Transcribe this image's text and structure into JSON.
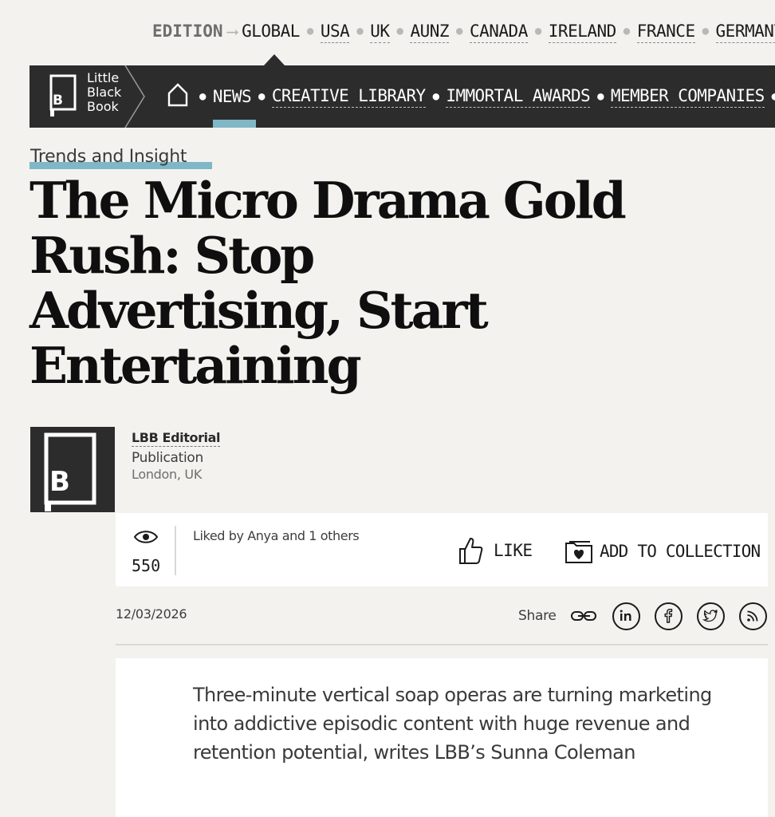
{
  "edition": {
    "label": "EDITION",
    "arrow": "⟶",
    "items": [
      "GLOBAL",
      "USA",
      "UK",
      "AUNZ",
      "CANADA",
      "IRELAND",
      "FRANCE",
      "GERMANY"
    ],
    "selected": "GLOBAL"
  },
  "nav": {
    "logo_lines": [
      "Little",
      "Black",
      "Book"
    ],
    "logo_letter": "B",
    "items": [
      "NEWS",
      "CREATIVE LIBRARY",
      "IMMORTAL AWARDS",
      "MEMBER COMPANIES"
    ],
    "active": "NEWS"
  },
  "article": {
    "category": "Trends and Insight",
    "headline_lines": [
      "The Micro Drama Gold",
      "Rush: Stop",
      "Advertising, Start",
      "Entertaining"
    ],
    "author": {
      "name": "LBB Editorial",
      "type": "Publication",
      "location": "London, UK"
    },
    "views": "550",
    "liked_by": "Liked by Anya and 1 others",
    "like_label": "LIKE",
    "collect_label": "ADD TO COLLECTION",
    "date": "12/03/2026",
    "share_label": "Share",
    "share_icons": [
      "link-icon",
      "linkedin-icon",
      "facebook-icon",
      "twitter-icon",
      "rss-icon"
    ],
    "standfirst": "Three-minute vertical soap operas are turning marketing into addictive episodic content with huge revenue and retention potential, writes LBB’s Sunna Coleman"
  },
  "colors": {
    "accent": "#7fb7c6",
    "nav_bg": "#2c2c2c",
    "page_bg": "#f3f2ee"
  }
}
